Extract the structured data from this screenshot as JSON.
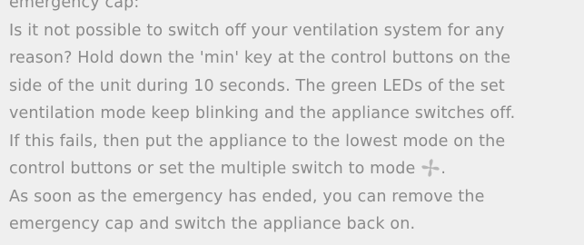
{
  "paragraph": {
    "lines": [
      "emergency cap:",
      "Is it not possible to switch off your ventilation system for any",
      "reason? Hold down the 'min' key at the control buttons on the",
      "side of the unit during 10 seconds. The green LEDs of the set",
      "ventilation mode keep blinking and the appliance switches off.",
      "If this fails, then put the appliance to the lowest mode on the",
      "control buttons or set the multiple switch to mode",
      "As soon as the emergency has ended, you can remove the",
      "emergency cap and switch the appliance back on."
    ],
    "mode_icon": "fan-icon",
    "mode_suffix": "."
  },
  "colors": {
    "background": "#efefef",
    "text": "#8a8a8a"
  }
}
